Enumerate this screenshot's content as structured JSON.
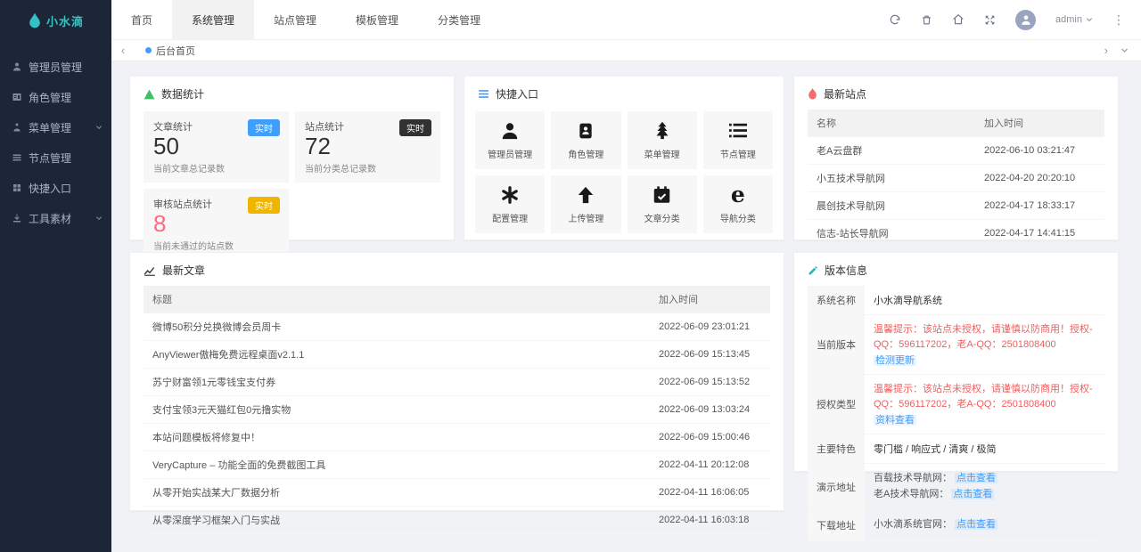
{
  "brand": {
    "name": "小水滴",
    "color": "#35c2c5"
  },
  "sidebar": {
    "items": [
      {
        "icon": "user-icon",
        "label": "管理员管理"
      },
      {
        "icon": "role-icon",
        "label": "角色管理"
      },
      {
        "icon": "menu-icon",
        "label": "菜单管理",
        "chevron": true
      },
      {
        "icon": "node-icon",
        "label": "节点管理"
      },
      {
        "icon": "entry-icon",
        "label": "快捷入口"
      },
      {
        "icon": "material-icon",
        "label": "工具素材",
        "chevron": true
      }
    ]
  },
  "topnav": {
    "tabs": [
      {
        "label": "首页",
        "active": false
      },
      {
        "label": "系统管理",
        "active": true
      },
      {
        "label": "站点管理",
        "active": false
      },
      {
        "label": "模板管理",
        "active": false
      },
      {
        "label": "分类管理",
        "active": false
      }
    ],
    "icons": [
      "refresh-icon",
      "clear-icon",
      "home-icon",
      "fullscreen-icon"
    ],
    "user": {
      "name": "admin"
    }
  },
  "breadcrumb": {
    "current": "后台首页"
  },
  "stats": {
    "title": "数据统计",
    "items": [
      {
        "label": "文章统计",
        "value": "50",
        "desc": "当前文章总记录数",
        "badge": "实时",
        "badge_style": "background:#409eff",
        "value_style": "color:#303133"
      },
      {
        "label": "站点统计",
        "value": "72",
        "desc": "当前分类总记录数",
        "badge": "实时",
        "badge_style": "background:#303133",
        "value_style": "color:#303133"
      },
      {
        "label": "审核站点统计",
        "value": "8",
        "desc": "当前未通过的站点数",
        "badge": "实时",
        "badge_style": "background:#efb500",
        "value_style": "color:#ff6a7d"
      }
    ]
  },
  "quick": {
    "title": "快捷入口",
    "items": [
      {
        "icon": "admin-icon",
        "label": "管理员管理"
      },
      {
        "icon": "role-card-icon",
        "label": "角色管理"
      },
      {
        "icon": "tree-icon",
        "label": "菜单管理"
      },
      {
        "icon": "list-icon",
        "label": "节点管理"
      },
      {
        "icon": "config-icon",
        "label": "配置管理"
      },
      {
        "icon": "upload-icon",
        "label": "上传管理"
      },
      {
        "icon": "calendar-icon",
        "label": "文章分类"
      },
      {
        "icon": "nav-e-icon",
        "label": "导航分类"
      }
    ]
  },
  "sites": {
    "title": "最新站点",
    "columns": {
      "name": "名称",
      "time": "加入时间"
    },
    "rows": [
      {
        "name": "老A云盘群",
        "time": "2022-06-10 03:21:47"
      },
      {
        "name": "小五技术导航网",
        "time": "2022-04-20 20:20:10"
      },
      {
        "name": "晨创技术导航网",
        "time": "2022-04-17 18:33:17"
      },
      {
        "name": "信志-站长导航网",
        "time": "2022-04-17 14:41:15"
      }
    ]
  },
  "articles": {
    "title": "最新文章",
    "columns": {
      "title": "标题",
      "time": "加入时间"
    },
    "rows": [
      {
        "title": "微博50积分兑换微博会员周卡",
        "time": "2022-06-09 23:01:21"
      },
      {
        "title": "AnyViewer傲梅免费远程桌面v2.1.1",
        "time": "2022-06-09 15:13:45"
      },
      {
        "title": "苏宁财富领1元零钱宝支付券",
        "time": "2022-06-09 15:13:52"
      },
      {
        "title": "支付宝领3元天猫红包0元撸实物",
        "time": "2022-06-09 13:03:24"
      },
      {
        "title": "本站问题模板将修复中！",
        "time": "2022-06-09 15:00:46"
      },
      {
        "title": "VeryCapture – 功能全面的免费截图工具",
        "time": "2022-04-11 20:12:08"
      },
      {
        "title": "从零开始实战某大厂数据分析",
        "time": "2022-04-11 16:06:05"
      },
      {
        "title": "从零深度学习框架入门与实战",
        "time": "2022-04-11 16:03:18"
      }
    ]
  },
  "version": {
    "title": "版本信息",
    "rows": {
      "name": {
        "label": "系统名称",
        "value": "小水滴导航系统"
      },
      "current": {
        "label": "当前版本",
        "warning": "温馨提示：该站点未授权，请谨慎以防商用！授权-QQ：596117202，老A-QQ：2501808400",
        "link": "检测更新"
      },
      "license": {
        "label": "授权类型",
        "warning": "温馨提示：该站点未授权，请谨慎以防商用！授权-QQ：596117202，老A-QQ：2501808400",
        "link": "资料查看"
      },
      "features": {
        "label": "主要特色",
        "value": "零门槛 / 响应式 / 清爽 / 极简"
      },
      "demo": {
        "label": "演示地址",
        "line1_text": "百载技术导航网：",
        "line1_link": "点击查看",
        "line2_text": "老A技术导航网：",
        "line2_link": "点击查看"
      },
      "download": {
        "label": "下载地址",
        "line1_text": "小水滴系统官网：",
        "line1_link": "点击查看"
      }
    }
  },
  "colors": {
    "accent_blue": "#409eff",
    "brand_teal": "#35c2c5",
    "warning_red": "#f45c5c",
    "badge_dark": "#303133",
    "badge_yellow": "#efb500",
    "sidebar_bg": "#1d2637"
  }
}
